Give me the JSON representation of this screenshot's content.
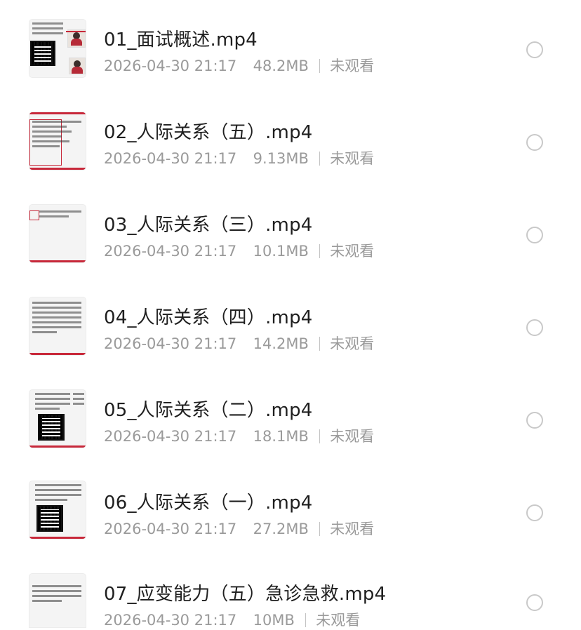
{
  "files": [
    {
      "name": "01_面试概述.mp4",
      "date": "2026-04-30 21:17",
      "size": "48.2MB",
      "status": "未观看",
      "thumb_icon": "video-thumbnail-qr-and-photo-icon"
    },
    {
      "name": "02_人际关系（五）.mp4",
      "date": "2026-04-30 21:17",
      "size": "9.13MB",
      "status": "未观看",
      "thumb_icon": "video-thumbnail-slide-icon"
    },
    {
      "name": "03_人际关系（三）.mp4",
      "date": "2026-04-30 21:17",
      "size": "10.1MB",
      "status": "未观看",
      "thumb_icon": "video-thumbnail-slide-icon"
    },
    {
      "name": "04_人际关系（四）.mp4",
      "date": "2026-04-30 21:17",
      "size": "14.2MB",
      "status": "未观看",
      "thumb_icon": "video-thumbnail-text-icon"
    },
    {
      "name": "05_人际关系（二）.mp4",
      "date": "2026-04-30 21:17",
      "size": "18.1MB",
      "status": "未观看",
      "thumb_icon": "video-thumbnail-qr-icon"
    },
    {
      "name": "06_人际关系（一）.mp4",
      "date": "2026-04-30 21:17",
      "size": "27.2MB",
      "status": "未观看",
      "thumb_icon": "video-thumbnail-qr-icon"
    },
    {
      "name": "07_应变能力（五）急诊急救.mp4",
      "date": "2026-04-30 21:17",
      "size": "10MB",
      "status": "未观看",
      "thumb_icon": "video-thumbnail-text-icon"
    }
  ],
  "colors": {
    "title_text": "#1f1f1f",
    "meta_text": "#9a9a9a",
    "radio_border": "#c9c9c9",
    "thumb_accent": "#c8283a"
  }
}
